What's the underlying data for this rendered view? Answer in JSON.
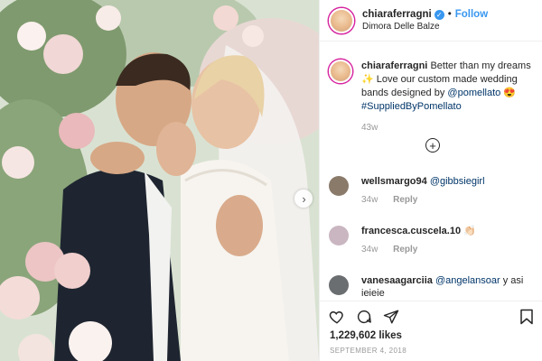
{
  "header": {
    "username": "chiaraferragni",
    "follow_label": "Follow",
    "separator": "•",
    "location": "Dimora Delle Balze"
  },
  "caption": {
    "username": "chiaraferragni",
    "text_1": "Better than my dreams ",
    "sparkle": "✨",
    "text_2": " Love our custom made wedding bands designed by ",
    "mention": "@pomellato",
    "emoji": "😍",
    "hashtag": "#SuppliedByPomellato",
    "time": "43w"
  },
  "load_more_icon": "plus-circle-icon",
  "comments": [
    {
      "username": "wellsmargo94",
      "text": "@gibbsiegirl",
      "text_is_mention": true,
      "time": "34w",
      "reply_label": "Reply",
      "avatar_color": "#8a7a6a"
    },
    {
      "username": "francesca.cuscela.10",
      "text": "👏🏻",
      "text_is_mention": false,
      "time": "34w",
      "reply_label": "Reply",
      "avatar_color": "#c9b6c0"
    },
    {
      "username": "vanesaagarciia",
      "mention": "@angelansoar",
      "text": " y asi jejeje",
      "avatar_color": "#6b6e70"
    }
  ],
  "actions": {
    "icons": [
      "heart-icon",
      "comment-icon",
      "share-icon",
      "bookmark-icon"
    ]
  },
  "likes": "1,229,602 likes",
  "date": "SEPTEMBER 4, 2018",
  "colors": {
    "accent_blue": "#3897f0",
    "link_dark_blue": "#003569",
    "muted_gray": "#999999",
    "divider": "#efefef"
  }
}
